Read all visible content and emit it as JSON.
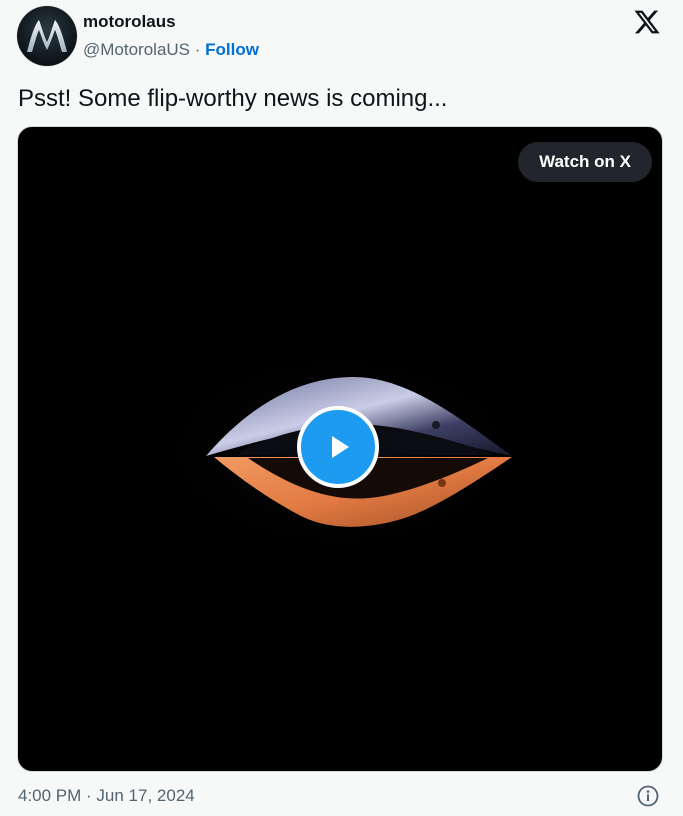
{
  "author": {
    "display_name": "motorolaus",
    "handle": "@MotorolaUS",
    "separator": "·",
    "follow_label": "Follow"
  },
  "tweet": {
    "text": "Psst! Some flip-worthy news is coming...",
    "timestamp": "4:00 PM · Jun 17, 2024"
  },
  "media": {
    "watch_label": "Watch on X"
  },
  "colors": {
    "follow_link": "#006fd6",
    "play_button": "#1d9bf0",
    "media_background": "#000000",
    "muted_text": "#536471"
  },
  "icons": {
    "logo": "x-logo-icon",
    "play": "play-icon",
    "info": "info-icon",
    "avatar": "motorola-logo-icon"
  }
}
